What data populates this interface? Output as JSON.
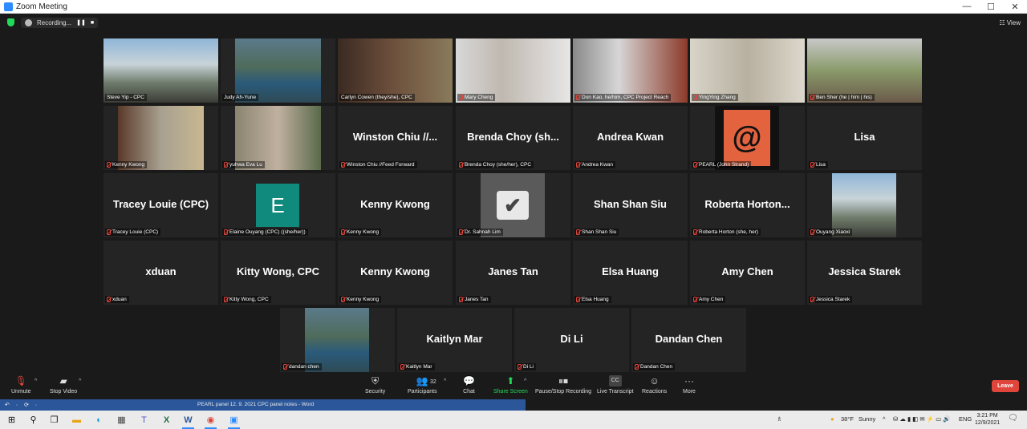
{
  "window": {
    "title": "Zoom Meeting",
    "controls": [
      "—",
      "☐",
      "✕"
    ]
  },
  "topbar": {
    "recording_label": "Recording...",
    "pause_glyph": "❚❚",
    "stop_glyph": "■",
    "view_label": "View"
  },
  "participants": [
    {
      "label": "Steve Yip - CPC",
      "type": "video",
      "muted": false
    },
    {
      "label": "Judy Ah-Yune",
      "type": "video",
      "muted": false
    },
    {
      "label": "Carlyn Cowen (they/she), CPC",
      "type": "video",
      "muted": false,
      "active": true
    },
    {
      "label": "Mary Cheng",
      "type": "video",
      "muted": true
    },
    {
      "label": "Don Kao, he/him, CPC Project Reach",
      "type": "video",
      "muted": true
    },
    {
      "label": "YingYing Zhang",
      "type": "video",
      "muted": true
    },
    {
      "label": "Ben Sher (he | him | his)",
      "type": "video",
      "muted": true
    },
    {
      "label": "Kenny Kwong",
      "type": "video",
      "muted": true
    },
    {
      "label": "yuhwa Eva Lu",
      "type": "video",
      "muted": true
    },
    {
      "label": "Winston Chiu //Feed Forward",
      "display": "Winston Chiu //...",
      "type": "name",
      "muted": true
    },
    {
      "label": "Brenda Choy (she/her), CPC",
      "display": "Brenda Choy (sh...",
      "type": "name",
      "muted": true
    },
    {
      "label": "Andrea Kwan",
      "display": "Andrea Kwan",
      "type": "name",
      "muted": true
    },
    {
      "label": "PEARL (John Strand)",
      "type": "logo",
      "muted": true
    },
    {
      "label": "Lisa",
      "display": "Lisa",
      "type": "name",
      "muted": true
    },
    {
      "label": "Tracey Louie (CPC)",
      "display": "Tracey Louie (CPC)",
      "type": "name",
      "muted": true
    },
    {
      "label": "Elaine Ouyang (CPC) ((she/her))",
      "avatar_letter": "E",
      "type": "letter",
      "muted": true
    },
    {
      "label": "Kenny Kwong",
      "display": "Kenny Kwong",
      "type": "name",
      "muted": true
    },
    {
      "label": "Dr. Sahnah Lim",
      "type": "check",
      "muted": true
    },
    {
      "label": "Shan Shan Siu",
      "display": "Shan Shan Siu",
      "type": "name",
      "muted": true
    },
    {
      "label": "Roberta Horton (she, her)",
      "display": "Roberta Horton...",
      "type": "name",
      "muted": true
    },
    {
      "label": "Ouyang Xiaoxi",
      "type": "video",
      "muted": true
    },
    {
      "label": "xduan",
      "display": "xduan",
      "type": "name",
      "muted": true
    },
    {
      "label": "Kitty Wong, CPC",
      "display": "Kitty Wong, CPC",
      "type": "name",
      "muted": true
    },
    {
      "label": "Kenny Kwong",
      "display": "Kenny Kwong",
      "type": "name",
      "muted": true
    },
    {
      "label": "Janes Tan",
      "display": "Janes Tan",
      "type": "name",
      "muted": true
    },
    {
      "label": "Elsa Huang",
      "display": "Elsa Huang",
      "type": "name",
      "muted": true
    },
    {
      "label": "Amy Chen",
      "display": "Amy Chen",
      "type": "name",
      "muted": true
    },
    {
      "label": "Jessica Starek",
      "display": "Jessica Starek",
      "type": "name",
      "muted": true
    },
    {
      "label": "dandan chen",
      "type": "video",
      "muted": true
    },
    {
      "label": "Kaitlyn Mar",
      "display": "Kaitlyn Mar",
      "type": "name",
      "muted": true
    },
    {
      "label": "Di Li",
      "display": "Di Li",
      "type": "name",
      "muted": true
    },
    {
      "label": "Dandan Chen",
      "display": "Dandan Chen",
      "type": "name",
      "muted": true
    }
  ],
  "toolbar": {
    "unmute": "Unmute",
    "stop_video": "Stop Video",
    "security": "Security",
    "participants": "Participants",
    "participants_count": "32",
    "chat": "Chat",
    "share_screen": "Share Screen",
    "pause_stop_recording": "Pause/Stop Recording",
    "live_transcript": "Live Transcript",
    "cc_glyph": "CC",
    "reactions": "Reactions",
    "more": "More",
    "leave": "Leave"
  },
  "word": {
    "quick_access": "↶ · ⟳ ·",
    "doc_title": "PEARL panel 12. 9. 2021 CPC panel notes  -  Word"
  },
  "taskbar": {
    "weather_temp": "38°F",
    "weather_desc": "Sunny",
    "lang": "ENG",
    "time": "3:21 PM",
    "date": "12/9/2021"
  },
  "colors": {
    "active_speaker": "#c5d83c",
    "leave": "#e0453b",
    "share_green": "#23d959",
    "elaine_avatar": "#0f8a7c",
    "pearl_logo": "#e4633f"
  }
}
